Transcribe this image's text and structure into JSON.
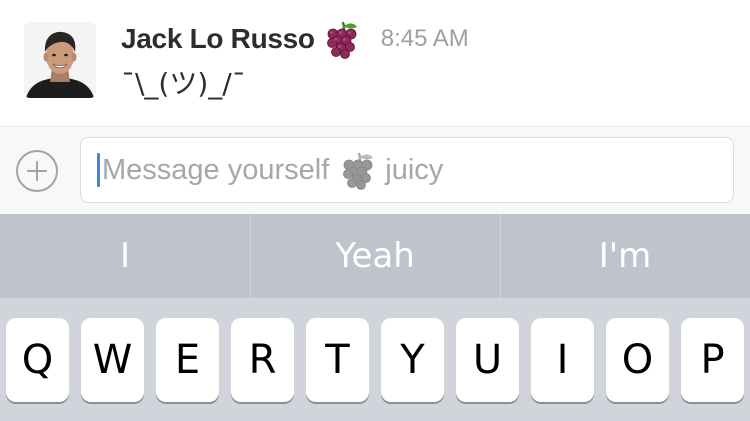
{
  "message": {
    "sender_name": "Jack Lo Russo",
    "status_emoji": "grapes-emoji",
    "timestamp": "8:45 AM",
    "text": "¯\\_(ツ)_/¯"
  },
  "composer": {
    "add_button_icon": "plus-circle-icon",
    "placeholder_prefix": "Message yourself",
    "placeholder_emoji": "grapes-emoji",
    "placeholder_suffix": "juicy"
  },
  "keyboard": {
    "suggestions": [
      "I",
      "Yeah",
      "I'm"
    ],
    "top_row_keys": [
      "Q",
      "W",
      "E",
      "R",
      "T",
      "Y",
      "U",
      "I",
      "O",
      "P"
    ]
  },
  "colors": {
    "caret": "#3c89d8",
    "suggestion_bar": "#bec3cc",
    "keyboard_bg": "#d1d4da"
  }
}
